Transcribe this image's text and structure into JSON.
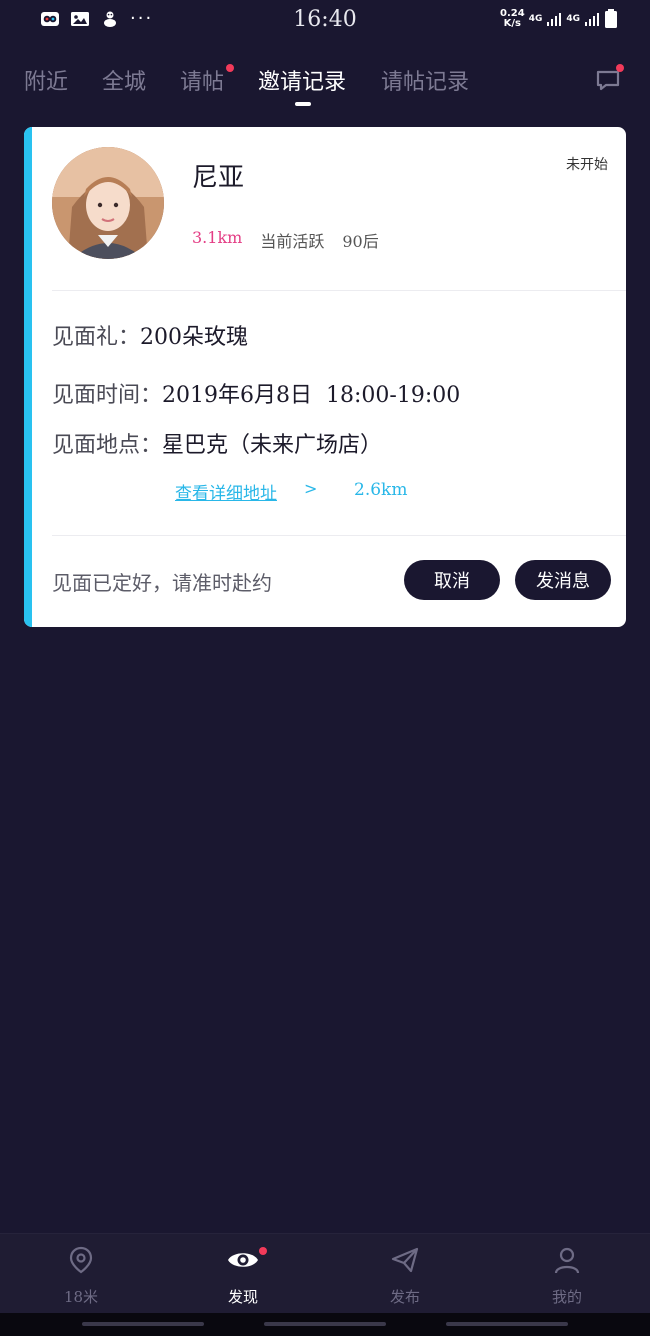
{
  "status_bar": {
    "time": "16:40",
    "net_speed_value": "0.24",
    "net_speed_unit": "K/s",
    "net_label_1": "4G",
    "net_label_2": "4G",
    "more": "···"
  },
  "tabs": [
    {
      "label": "附近",
      "active": false,
      "dot": false
    },
    {
      "label": "全城",
      "active": false,
      "dot": false
    },
    {
      "label": "请帖",
      "active": false,
      "dot": true
    },
    {
      "label": "邀请记录",
      "active": true,
      "dot": false
    },
    {
      "label": "请帖记录",
      "active": false,
      "dot": false
    }
  ],
  "card": {
    "name": "尼亚",
    "status": "未开始",
    "distance": "3.1km",
    "activity": "当前活跃",
    "age": "90后",
    "gift_label": "见面礼：",
    "gift_value": "200朵玫瑰",
    "time_label": "见面时间：",
    "time_value": "2019年6月8日  18:00-19:00",
    "place_label": "见面地点：",
    "place_value": "星巴克（未来广场店）",
    "detail_link": "查看详细地址",
    "detail_chevron": ">",
    "detail_distance": "2.6km",
    "footer_note": "见面已定好，请准时赴约",
    "cancel_label": "取消",
    "message_label": "发消息",
    "accent_color": "#29c2f0"
  },
  "bottom_nav": [
    {
      "label": "18米",
      "icon": "location-pin-icon",
      "active": false
    },
    {
      "label": "发现",
      "icon": "eye-icon",
      "active": true,
      "dot": true
    },
    {
      "label": "发布",
      "icon": "paper-plane-icon",
      "active": false
    },
    {
      "label": "我的",
      "icon": "person-icon",
      "active": false
    }
  ]
}
